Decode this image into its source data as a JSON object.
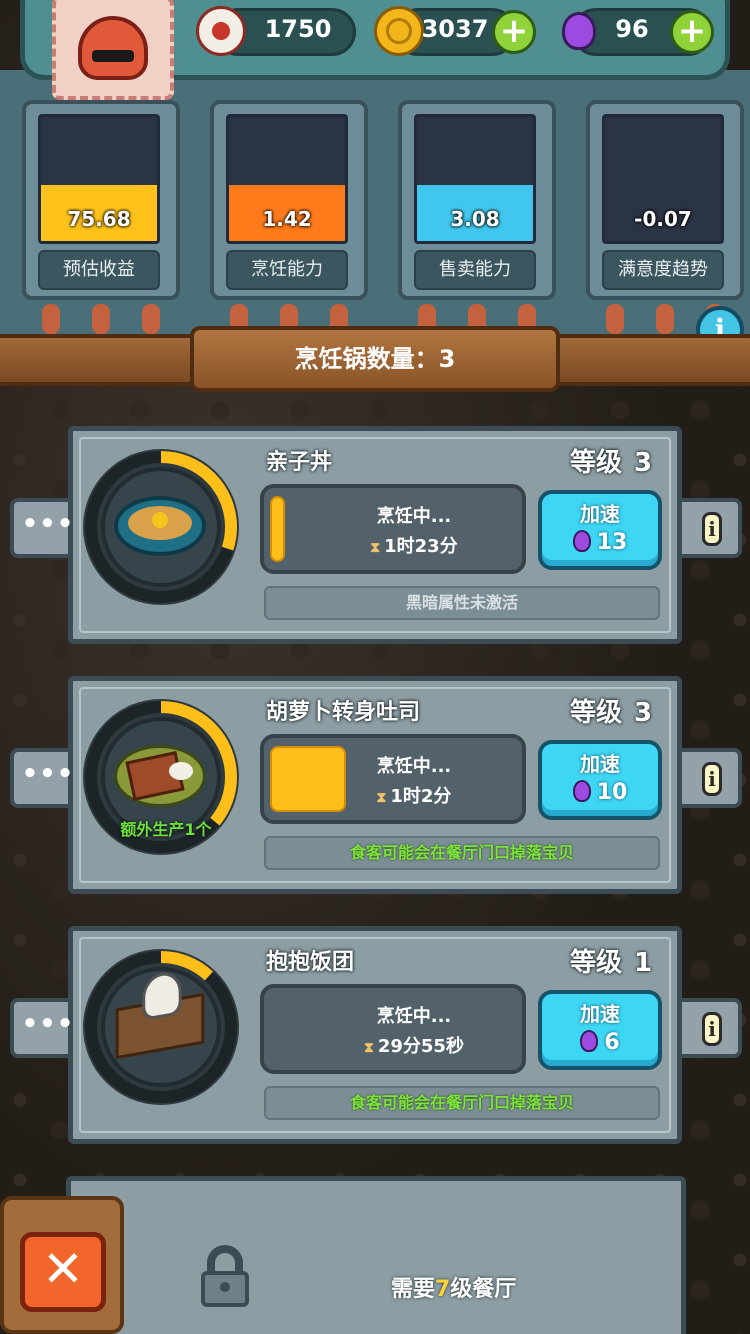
{
  "resources": {
    "eyeball": {
      "value": "1750",
      "icon": "eyeball-icon"
    },
    "coin": {
      "value": "3037",
      "icon": "coin-icon",
      "plus": "+"
    },
    "potion": {
      "value": "96",
      "icon": "potion-icon",
      "plus": "+"
    }
  },
  "stats": [
    {
      "label": "预估收益",
      "value": "75.68",
      "fill": 0.45,
      "color": "#ffc21a"
    },
    {
      "label": "烹饪能力",
      "value": "1.42",
      "fill": 0.45,
      "color": "#ff7a1a"
    },
    {
      "label": "售卖能力",
      "value": "3.08",
      "fill": 0.45,
      "color": "#41c7ee"
    },
    {
      "label": "满意度趋势",
      "value": "-0.07",
      "fill": 0.0,
      "color": "#41c7ee"
    }
  ],
  "info_symbol": "i",
  "banner": {
    "text": "烹饪锅数量：3"
  },
  "cards": [
    {
      "name": "亲子丼",
      "level_label": "等级",
      "level": "3",
      "status": "烹饪中...",
      "time": "1时23分",
      "progress": 0.06,
      "ring_progress": 0.3,
      "speed_label": "加速",
      "speed_cost": "13",
      "hint": "黑暗属性未激活",
      "hint_style": "gray",
      "extra": "",
      "dish_icon": "rice-bowl-icon",
      "more_label": "•••",
      "info_label": "i"
    },
    {
      "name": "胡萝卜转身吐司",
      "level_label": "等级",
      "level": "3",
      "status": "烹饪中...",
      "time": "1时2分",
      "progress": 0.3,
      "ring_progress": 0.36,
      "speed_label": "加速",
      "speed_cost": "10",
      "hint": "食客可能会在餐厅门口掉落宝贝",
      "hint_style": "green",
      "extra": "额外生产1个",
      "dish_icon": "toast-icon",
      "more_label": "•••",
      "info_label": "i"
    },
    {
      "name": "抱抱饭团",
      "level_label": "等级",
      "level": "1",
      "status": "烹饪中...",
      "time": "29分55秒",
      "progress": 0.0,
      "ring_progress": 0.12,
      "speed_label": "加速",
      "speed_cost": "6",
      "hint": "食客可能会在餐厅门口掉落宝贝",
      "hint_style": "green",
      "extra": "",
      "dish_icon": "rice-ball-icon",
      "more_label": "•••",
      "info_label": "i"
    }
  ],
  "locked": {
    "prefix": "需要",
    "level": "7",
    "suffix": "级餐厅"
  },
  "close_label": "✕",
  "colors": {
    "ring": "#ffbf1a",
    "speed_btn": "#3dd6f4",
    "progress": "#ffbf1a"
  }
}
